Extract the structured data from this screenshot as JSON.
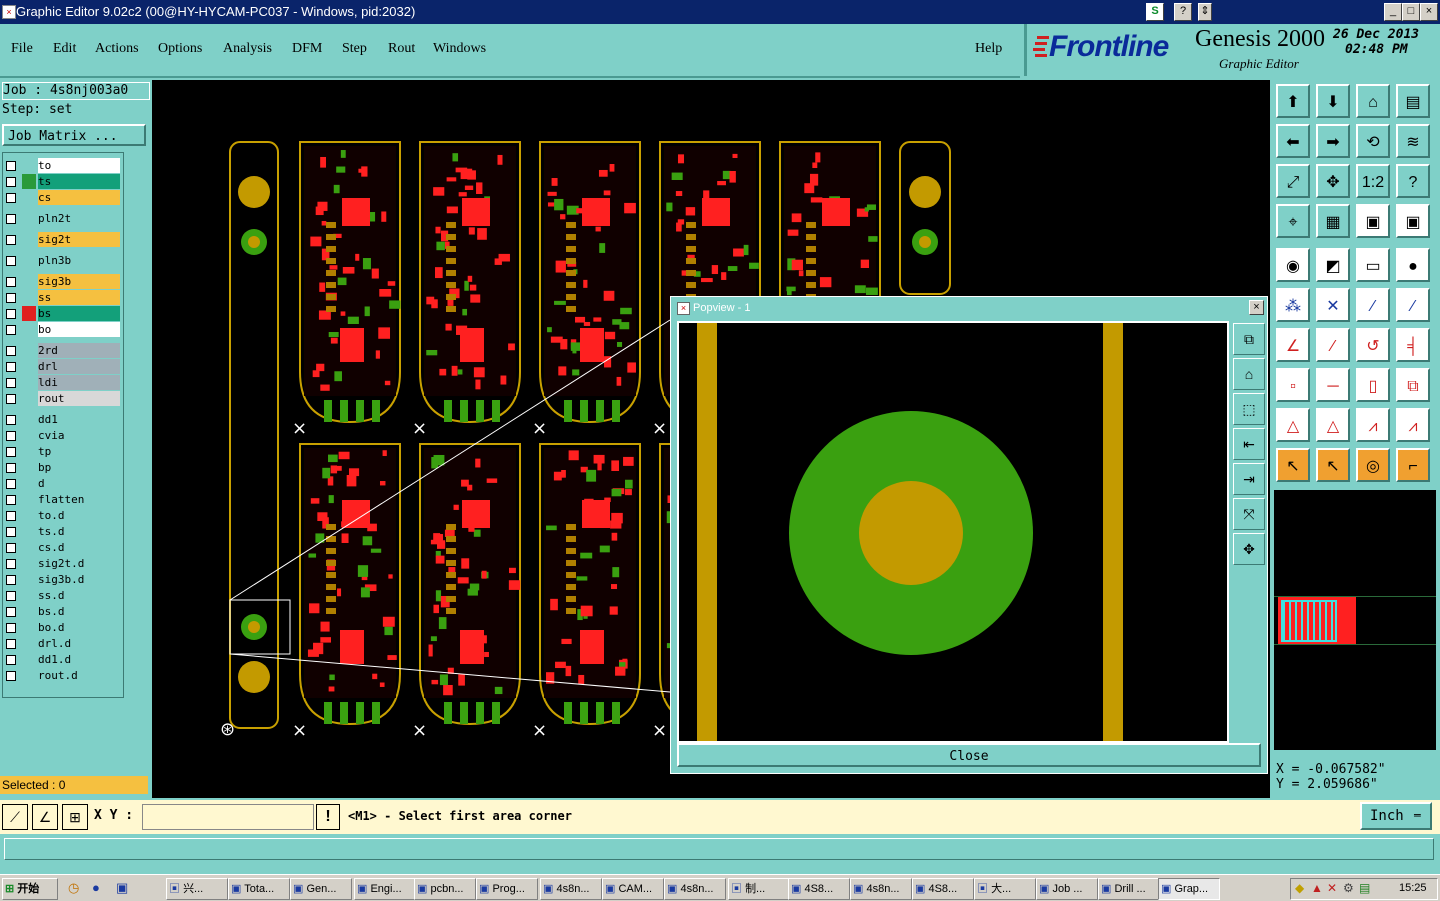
{
  "window": {
    "title": "Graphic Editor 9.02c2 (00@HY-HYCAM-PC037 - Windows, pid:2032)",
    "buttons": [
      "_",
      "□",
      "×"
    ]
  },
  "menu": {
    "items": [
      "File",
      "Edit",
      "Actions",
      "Options",
      "Analysis",
      "DFM",
      "Step",
      "Rout",
      "Windows"
    ],
    "help": "Help"
  },
  "brand": {
    "logo": "Frontline",
    "product": "Genesis 2000",
    "subtitle": "Graphic Editor",
    "date": "26 Dec 2013",
    "time": "02:48 PM"
  },
  "job": {
    "job_line": "Job : 4s8nj003a0",
    "step_line": "Step: set",
    "matrix_button": "Job Matrix ..."
  },
  "layers": [
    {
      "name": "to",
      "color": "#ffffff",
      "swatch": "#7fd0c8"
    },
    {
      "name": "ts",
      "color": "#13a07a",
      "swatch": "#2a9a3a"
    },
    {
      "name": "cs",
      "color": "#f5c040",
      "swatch": "#7fd0c8"
    },
    {
      "name": "pln2t",
      "color": "#7fd0c8",
      "swatch": "#7fd0c8"
    },
    {
      "name": "sig2t",
      "color": "#f5c040",
      "swatch": "#7fd0c8"
    },
    {
      "name": "pln3b",
      "color": "#7fd0c8",
      "swatch": "#7fd0c8"
    },
    {
      "name": "sig3b",
      "color": "#f5c040",
      "swatch": "#7fd0c8"
    },
    {
      "name": "ss",
      "color": "#f5c040",
      "swatch": "#7fd0c8"
    },
    {
      "name": "bs",
      "color": "#13a07a",
      "swatch": "#e02020"
    },
    {
      "name": "bo",
      "color": "#ffffff",
      "swatch": "#7fd0c8"
    },
    {
      "name": "2rd",
      "color": "#a0b0b8",
      "swatch": "#7fd0c8"
    },
    {
      "name": "drl",
      "color": "#a0b0b8",
      "swatch": "#7fd0c8"
    },
    {
      "name": "ldi",
      "color": "#a0b0b8",
      "swatch": "#7fd0c8"
    },
    {
      "name": "rout",
      "color": "#d8d8d8",
      "swatch": "#7fd0c8"
    },
    {
      "name": "dd1",
      "color": "#7fd0c8",
      "swatch": "#7fd0c8"
    },
    {
      "name": "cvia",
      "color": "#7fd0c8",
      "swatch": "#7fd0c8"
    },
    {
      "name": "tp",
      "color": "#7fd0c8",
      "swatch": "#7fd0c8"
    },
    {
      "name": "bp",
      "color": "#7fd0c8",
      "swatch": "#7fd0c8"
    },
    {
      "name": "d",
      "color": "#7fd0c8",
      "swatch": "#7fd0c8"
    },
    {
      "name": "flatten",
      "color": "#7fd0c8",
      "swatch": "#7fd0c8"
    },
    {
      "name": "to.d",
      "color": "#7fd0c8",
      "swatch": "#7fd0c8"
    },
    {
      "name": "ts.d",
      "color": "#7fd0c8",
      "swatch": "#7fd0c8"
    },
    {
      "name": "cs.d",
      "color": "#7fd0c8",
      "swatch": "#7fd0c8"
    },
    {
      "name": "sig2t.d",
      "color": "#7fd0c8",
      "swatch": "#7fd0c8"
    },
    {
      "name": "sig3b.d",
      "color": "#7fd0c8",
      "swatch": "#7fd0c8"
    },
    {
      "name": "ss.d",
      "color": "#7fd0c8",
      "swatch": "#7fd0c8"
    },
    {
      "name": "bs.d",
      "color": "#7fd0c8",
      "swatch": "#7fd0c8"
    },
    {
      "name": "bo.d",
      "color": "#7fd0c8",
      "swatch": "#7fd0c8"
    },
    {
      "name": "drl.d",
      "color": "#7fd0c8",
      "swatch": "#7fd0c8"
    },
    {
      "name": "dd1.d",
      "color": "#7fd0c8",
      "swatch": "#7fd0c8"
    },
    {
      "name": "rout.d",
      "color": "#7fd0c8",
      "swatch": "#7fd0c8"
    }
  ],
  "selected_label": "Selected : 0",
  "popview": {
    "title": "Popview - 1",
    "close_label": "Close",
    "side_buttons": [
      "zoom-window",
      "zoom-home",
      "zoom-in",
      "zoom-out",
      "pan",
      "fit",
      "center"
    ]
  },
  "coords": {
    "x_line": "X = -0.067582\"",
    "y_line": "Y = 2.059686\""
  },
  "command": {
    "xy_label": "X Y :",
    "xy_value": "",
    "prompt": "<M1> - Select first area corner",
    "unit": "Inch"
  },
  "taskbar": {
    "start": "开始",
    "tasks": [
      "兴...",
      "Tota...",
      "Gen...",
      "Engi...",
      "pcbn...",
      "Prog...",
      "4s8n...",
      "CAM...",
      "4s8n...",
      "制...",
      "4S8...",
      "4s8n...",
      "4S8...",
      "大...",
      "Job ...",
      "Drill ...",
      "Grap..."
    ],
    "clock": "15:25"
  },
  "colors": {
    "panel": "#7fd0c8",
    "copper": "#c8a000",
    "pad_red": "#ff2020",
    "pad_green": "#3aa010",
    "canvas": "#000000"
  }
}
